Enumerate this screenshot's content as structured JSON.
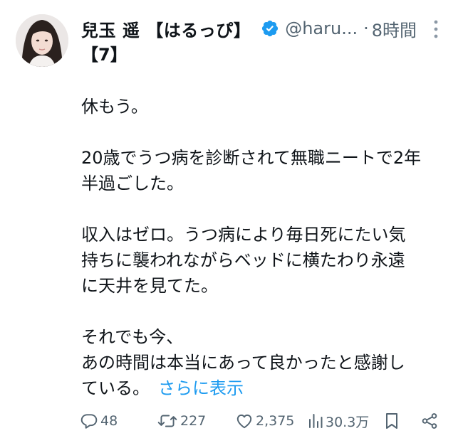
{
  "tweet": {
    "author_name": "兒玉 遥 【はるっぴ】",
    "author_name_cont": "【7】",
    "handle": "@haru...",
    "separator": "·",
    "time": "8時間",
    "lines": [
      "休もう。",
      "",
      "20歳でうつ病を診断されて無職ニートで2年",
      "半過ごした。",
      "",
      "収入はゼロ。うつ病により毎日死にたい気",
      "持ちに襲われながらベッドに横たわり永遠",
      "に天井を見てた。",
      "",
      "それでも今、",
      "あの時間は本当にあって良かったと感謝し",
      "ている。"
    ],
    "show_more": "さらに表示"
  },
  "actions": {
    "replies": "48",
    "reposts": "227",
    "likes": "2,375",
    "views": "30.3万"
  },
  "icons": {
    "verified": "verified-badge-icon",
    "more": "more-options-icon",
    "reply": "reply-icon",
    "repost": "repost-icon",
    "like": "heart-icon",
    "views": "views-icon",
    "bookmark": "bookmark-icon",
    "share": "share-icon"
  },
  "colors": {
    "text": "#0f1419",
    "secondary": "#536471",
    "link": "#1d9bf0"
  }
}
